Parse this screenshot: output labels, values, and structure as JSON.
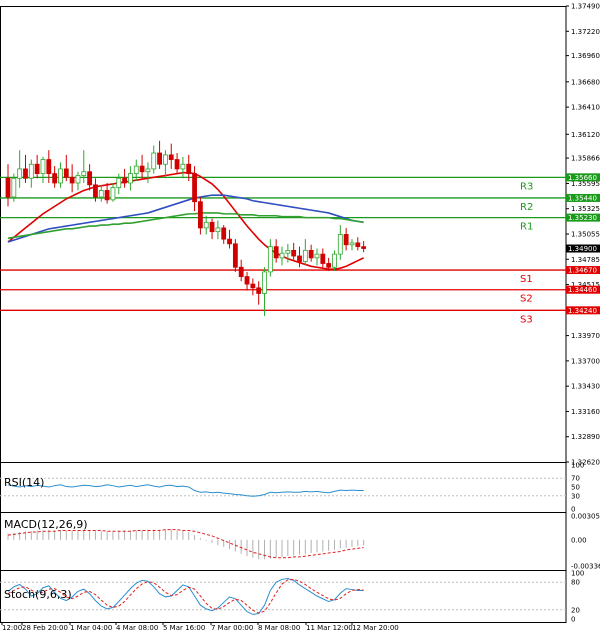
{
  "chart_data": {
    "type": "candlestick",
    "price_axis": {
      "min": 1.3262,
      "max": 1.3749,
      "ticks": [
        "1.37490",
        "1.37220",
        "1.36960",
        "1.36680",
        "1.36410",
        "1.36120",
        "1.35866",
        "1.35595",
        "1.35325",
        "1.35055",
        "1.34785",
        "1.34515",
        "1.34245",
        "1.33970",
        "1.33700",
        "1.33430",
        "1.33160",
        "1.32890",
        "1.32620"
      ]
    },
    "time_axis": {
      "labels": [
        "12:00",
        "28 Feb 20:00",
        "1 Mar 04:00",
        "4 Mar 08:00",
        "5 Mar 16:00",
        "7 Mar 00:00",
        "8 Mar 08:00",
        "11 Mar 12:00",
        "12 Mar 20:00"
      ]
    },
    "current_price": 1.349,
    "current_price_label": "1.34900",
    "levels": [
      {
        "name": "R3",
        "value": 1.3566,
        "label": "1.35660",
        "color": "#1a9a1a"
      },
      {
        "name": "R2",
        "value": 1.3544,
        "label": "1.35440",
        "color": "#1a9a1a"
      },
      {
        "name": "R1",
        "value": 1.3523,
        "label": "1.35230",
        "color": "#1a9a1a"
      },
      {
        "name": "S1",
        "value": 1.3467,
        "label": "1.34670",
        "color": "#e00000"
      },
      {
        "name": "S2",
        "value": 1.3446,
        "label": "1.34460",
        "color": "#e00000"
      },
      {
        "name": "S3",
        "value": 1.3424,
        "label": "1.34240",
        "color": "#e00000"
      }
    ],
    "candles": [
      [
        1.3565,
        1.358,
        1.3535,
        1.3545
      ],
      [
        1.3545,
        1.357,
        1.354,
        1.3565
      ],
      [
        1.3565,
        1.3595,
        1.3555,
        1.3575
      ],
      [
        1.3575,
        1.359,
        1.356,
        1.3565
      ],
      [
        1.3565,
        1.3585,
        1.3555,
        1.358
      ],
      [
        1.358,
        1.359,
        1.3565,
        1.357
      ],
      [
        1.357,
        1.3588,
        1.356,
        1.3585
      ],
      [
        1.3585,
        1.3595,
        1.356,
        1.357
      ],
      [
        1.357,
        1.3578,
        1.3555,
        1.356
      ],
      [
        1.356,
        1.3582,
        1.3555,
        1.3575
      ],
      [
        1.3575,
        1.359,
        1.3562,
        1.3566
      ],
      [
        1.3566,
        1.358,
        1.355,
        1.356
      ],
      [
        1.356,
        1.3572,
        1.3552,
        1.3568
      ],
      [
        1.3568,
        1.3595,
        1.356,
        1.3572
      ],
      [
        1.3572,
        1.358,
        1.3552,
        1.3558
      ],
      [
        1.3558,
        1.3565,
        1.354,
        1.3545
      ],
      [
        1.3545,
        1.3558,
        1.354,
        1.3552
      ],
      [
        1.3552,
        1.356,
        1.3538,
        1.3542
      ],
      [
        1.3542,
        1.356,
        1.354,
        1.3555
      ],
      [
        1.3555,
        1.357,
        1.3548,
        1.3565
      ],
      [
        1.3565,
        1.3575,
        1.3555,
        1.356
      ],
      [
        1.356,
        1.3578,
        1.3552,
        1.357
      ],
      [
        1.357,
        1.3585,
        1.3562,
        1.3578
      ],
      [
        1.3578,
        1.359,
        1.3565,
        1.3572
      ],
      [
        1.3572,
        1.3582,
        1.356,
        1.3575
      ],
      [
        1.3575,
        1.36,
        1.357,
        1.3592
      ],
      [
        1.3592,
        1.3605,
        1.3575,
        1.358
      ],
      [
        1.358,
        1.3595,
        1.3565,
        1.359
      ],
      [
        1.359,
        1.3602,
        1.3575,
        1.3585
      ],
      [
        1.3585,
        1.3592,
        1.357,
        1.3575
      ],
      [
        1.3575,
        1.3588,
        1.3565,
        1.358
      ],
      [
        1.358,
        1.359,
        1.3562,
        1.357
      ],
      [
        1.357,
        1.3578,
        1.353,
        1.354
      ],
      [
        1.354,
        1.3545,
        1.3505,
        1.3512
      ],
      [
        1.3512,
        1.3525,
        1.3505,
        1.3518
      ],
      [
        1.3518,
        1.3522,
        1.35,
        1.3508
      ],
      [
        1.3508,
        1.352,
        1.35,
        1.3512
      ],
      [
        1.3512,
        1.3515,
        1.3495,
        1.35
      ],
      [
        1.35,
        1.351,
        1.349,
        1.3495
      ],
      [
        1.3495,
        1.35,
        1.3465,
        1.347
      ],
      [
        1.347,
        1.3478,
        1.3455,
        1.346
      ],
      [
        1.346,
        1.3465,
        1.3445,
        1.3452
      ],
      [
        1.3452,
        1.3458,
        1.344,
        1.3448
      ],
      [
        1.3448,
        1.3455,
        1.343,
        1.3442
      ],
      [
        1.3442,
        1.347,
        1.3418,
        1.3465
      ],
      [
        1.3465,
        1.35,
        1.346,
        1.3492
      ],
      [
        1.3492,
        1.35,
        1.3475,
        1.348
      ],
      [
        1.348,
        1.3492,
        1.3472,
        1.3485
      ],
      [
        1.3485,
        1.3495,
        1.3475,
        1.3488
      ],
      [
        1.3488,
        1.3496,
        1.3478,
        1.3482
      ],
      [
        1.3482,
        1.3492,
        1.347,
        1.3476
      ],
      [
        1.3476,
        1.35,
        1.3472,
        1.3488
      ],
      [
        1.3488,
        1.3494,
        1.3476,
        1.348
      ],
      [
        1.348,
        1.349,
        1.3472,
        1.3484
      ],
      [
        1.3484,
        1.349,
        1.347,
        1.3474
      ],
      [
        1.3474,
        1.348,
        1.3466,
        1.347
      ],
      [
        1.347,
        1.3488,
        1.3466,
        1.3484
      ],
      [
        1.3484,
        1.3515,
        1.3478,
        1.3505
      ],
      [
        1.3505,
        1.3512,
        1.3488,
        1.3494
      ],
      [
        1.3494,
        1.35,
        1.3488,
        1.3496
      ],
      [
        1.3496,
        1.3502,
        1.3488,
        1.3492
      ],
      [
        1.3492,
        1.3498,
        1.3486,
        1.349
      ]
    ],
    "moving_averages": [
      {
        "color": "#e00000",
        "values": [
          1.3497,
          1.3502,
          1.3507,
          1.3512,
          1.3517,
          1.3522,
          1.3527,
          1.3531,
          1.3535,
          1.3539,
          1.3543,
          1.3546,
          1.3549,
          1.3552,
          1.3554,
          1.3556,
          1.3557,
          1.3558,
          1.3559,
          1.356,
          1.3561,
          1.3562,
          1.3563,
          1.3564,
          1.3565,
          1.3566,
          1.3567,
          1.3568,
          1.3569,
          1.357,
          1.3571,
          1.3571,
          1.357,
          1.3567,
          1.3563,
          1.3559,
          1.3553,
          1.3546,
          1.3538,
          1.353,
          1.3522,
          1.3514,
          1.3507,
          1.35,
          1.3494,
          1.3489,
          1.3485,
          1.3482,
          1.3479,
          1.3477,
          1.3475,
          1.3473,
          1.3471,
          1.347,
          1.3469,
          1.3468,
          1.3468,
          1.3469,
          1.3471,
          1.3474,
          1.3477,
          1.348
        ]
      },
      {
        "color": "#3050c0",
        "values": [
          1.3497,
          1.3499,
          1.3501,
          1.3503,
          1.3505,
          1.3507,
          1.3509,
          1.3511,
          1.3512,
          1.3513,
          1.3514,
          1.3515,
          1.3516,
          1.3517,
          1.3518,
          1.3519,
          1.352,
          1.3521,
          1.3522,
          1.3523,
          1.3524,
          1.3525,
          1.3526,
          1.3527,
          1.3528,
          1.353,
          1.3532,
          1.3534,
          1.3536,
          1.3538,
          1.354,
          1.3542,
          1.3544,
          1.3545,
          1.3546,
          1.3547,
          1.3547,
          1.3547,
          1.3546,
          1.3545,
          1.3544,
          1.3543,
          1.3541,
          1.354,
          1.3539,
          1.3538,
          1.3537,
          1.3536,
          1.3535,
          1.3534,
          1.3533,
          1.3532,
          1.3531,
          1.353,
          1.3529,
          1.3528,
          1.3526,
          1.3524,
          1.3522,
          1.352,
          1.3519,
          1.3518
        ]
      },
      {
        "color": "#30a030",
        "values": [
          1.3501,
          1.3502,
          1.3503,
          1.3504,
          1.3505,
          1.3506,
          1.3507,
          1.3508,
          1.3509,
          1.351,
          1.3511,
          1.3511,
          1.3512,
          1.3513,
          1.3514,
          1.3514,
          1.3515,
          1.3515,
          1.3516,
          1.3516,
          1.3517,
          1.3517,
          1.3518,
          1.3519,
          1.352,
          1.3521,
          1.3522,
          1.3523,
          1.3524,
          1.3525,
          1.3526,
          1.3527,
          1.3527,
          1.3528,
          1.3528,
          1.3528,
          1.3528,
          1.3527,
          1.3527,
          1.3527,
          1.3526,
          1.3526,
          1.3526,
          1.3525,
          1.3525,
          1.3525,
          1.3525,
          1.3524,
          1.3524,
          1.3524,
          1.3524,
          1.3523,
          1.3523,
          1.3523,
          1.3523,
          1.3523,
          1.3522,
          1.3522,
          1.3521,
          1.352,
          1.3519,
          1.3518
        ]
      }
    ],
    "rsi": {
      "label": "RSI(14)",
      "axis": [
        "100",
        "70",
        "50",
        "30",
        "0"
      ],
      "values": [
        55,
        52,
        50,
        53,
        51,
        54,
        52,
        50,
        53,
        55,
        51,
        50,
        52,
        54,
        53,
        51,
        52,
        55,
        53,
        50,
        52,
        54,
        51,
        53,
        55,
        52,
        50,
        53,
        54,
        51,
        52,
        50,
        42,
        38,
        39,
        37,
        38,
        36,
        35,
        33,
        32,
        30,
        29,
        30,
        33,
        38,
        37,
        38,
        39,
        38,
        38,
        40,
        39,
        40,
        38,
        37,
        40,
        43,
        42,
        43,
        42,
        42
      ]
    },
    "macd": {
      "label": "MACD(12,26,9)",
      "axis": [
        "0.003058",
        "0.00",
        "-0.003364"
      ],
      "histogram": [
        0.0008,
        0.0009,
        0.001,
        0.0011,
        0.0011,
        0.0012,
        0.0012,
        0.0012,
        0.0012,
        0.0012,
        0.0012,
        0.0012,
        0.0012,
        0.0012,
        0.0012,
        0.0011,
        0.0011,
        0.0011,
        0.0011,
        0.0011,
        0.0012,
        0.0012,
        0.0012,
        0.0012,
        0.0013,
        0.0013,
        0.0013,
        0.0013,
        0.0013,
        0.0012,
        0.0012,
        0.001,
        0.0006,
        0.0002,
        -0.0001,
        -0.0004,
        -0.0007,
        -0.0009,
        -0.0012,
        -0.0015,
        -0.0018,
        -0.0021,
        -0.0023,
        -0.0025,
        -0.0025,
        -0.0024,
        -0.0023,
        -0.0022,
        -0.0021,
        -0.002,
        -0.0019,
        -0.0018,
        -0.0017,
        -0.0016,
        -0.0015,
        -0.0014,
        -0.0013,
        -0.0011,
        -0.001,
        -0.0009,
        -0.0008,
        -0.0007
      ],
      "signal": [
        0.0006,
        0.0007,
        0.0008,
        0.0009,
        0.001,
        0.001,
        0.0011,
        0.0011,
        0.0011,
        0.0012,
        0.0012,
        0.0012,
        0.0012,
        0.0012,
        0.0012,
        0.0012,
        0.0012,
        0.0011,
        0.0011,
        0.0011,
        0.0011,
        0.0011,
        0.0012,
        0.0012,
        0.0012,
        0.0012,
        0.0012,
        0.0013,
        0.0013,
        0.0013,
        0.0012,
        0.0012,
        0.0011,
        0.0009,
        0.0007,
        0.0005,
        0.0002,
        -0.0001,
        -0.0004,
        -0.0007,
        -0.001,
        -0.0013,
        -0.0016,
        -0.0018,
        -0.002,
        -0.0022,
        -0.0023,
        -0.0023,
        -0.0023,
        -0.0022,
        -0.0022,
        -0.0021,
        -0.002,
        -0.0019,
        -0.0018,
        -0.0017,
        -0.0016,
        -0.0015,
        -0.0013,
        -0.0012,
        -0.0011,
        -0.001
      ]
    },
    "stoch": {
      "label": "Stoch(9,6,3)",
      "axis": [
        "100",
        "80",
        "20",
        "0"
      ],
      "main": [
        60,
        70,
        75,
        65,
        50,
        55,
        68,
        72,
        58,
        45,
        40,
        48,
        60,
        65,
        55,
        40,
        28,
        22,
        25,
        38,
        52,
        66,
        78,
        84,
        82,
        70,
        55,
        48,
        50,
        62,
        74,
        70,
        50,
        30,
        22,
        18,
        24,
        36,
        48,
        44,
        30,
        16,
        10,
        12,
        30,
        62,
        80,
        86,
        88,
        84,
        74,
        66,
        58,
        50,
        44,
        38,
        42,
        56,
        66,
        64,
        62,
        62
      ],
      "signal": [
        55,
        62,
        68,
        70,
        63,
        56,
        58,
        65,
        66,
        58,
        48,
        44,
        50,
        58,
        60,
        53,
        41,
        30,
        25,
        28,
        38,
        52,
        66,
        76,
        81,
        79,
        69,
        58,
        51,
        53,
        62,
        69,
        65,
        50,
        34,
        23,
        21,
        27,
        36,
        43,
        40,
        30,
        19,
        13,
        17,
        35,
        57,
        76,
        85,
        86,
        82,
        75,
        66,
        58,
        51,
        44,
        41,
        45,
        55,
        62,
        64,
        63
      ]
    }
  }
}
